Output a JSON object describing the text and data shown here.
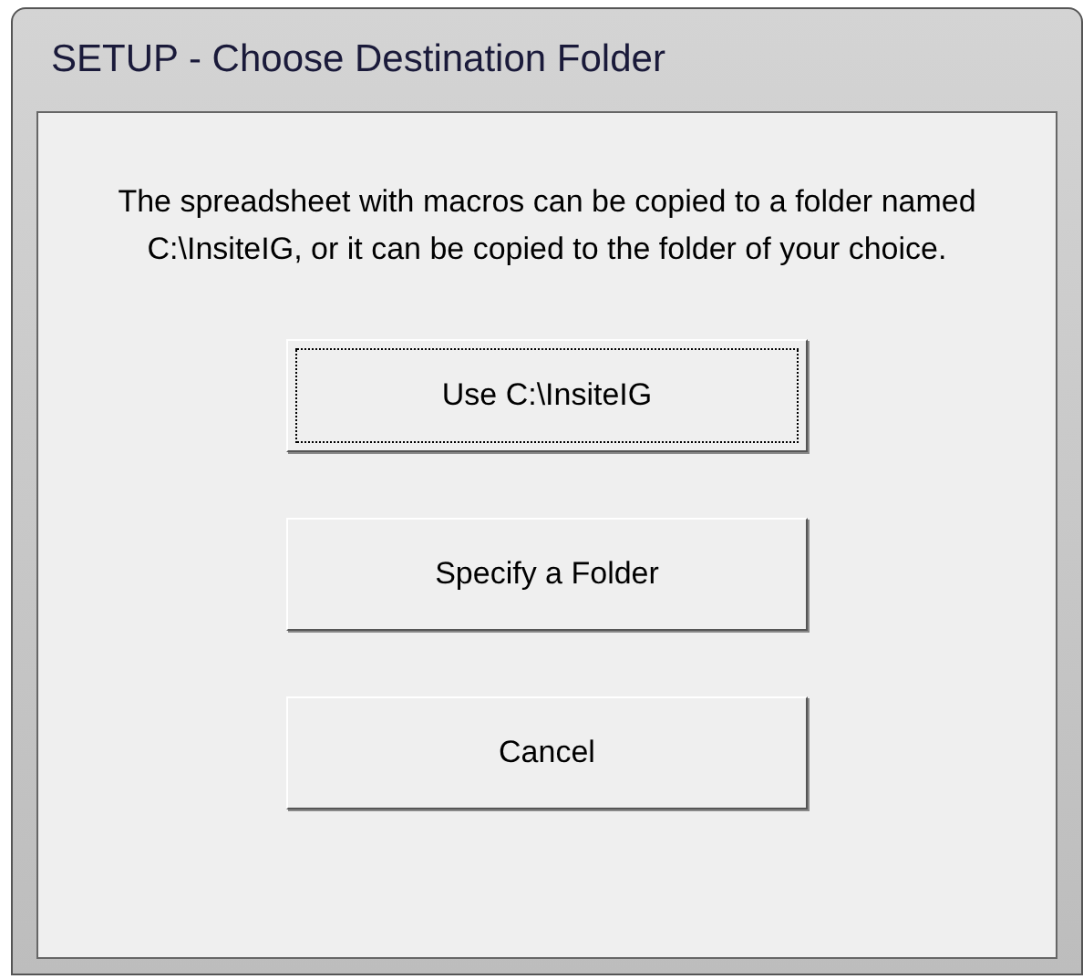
{
  "window": {
    "title": "SETUP - Choose Destination Folder"
  },
  "message": "The spreadsheet with macros can be copied to a folder named C:\\InsiteIG, or it can be copied to the folder of your choice.",
  "buttons": [
    {
      "label": "Use C:\\InsiteIG",
      "focused": true
    },
    {
      "label": "Specify a Folder",
      "focused": false
    },
    {
      "label": "Cancel",
      "focused": false
    }
  ]
}
